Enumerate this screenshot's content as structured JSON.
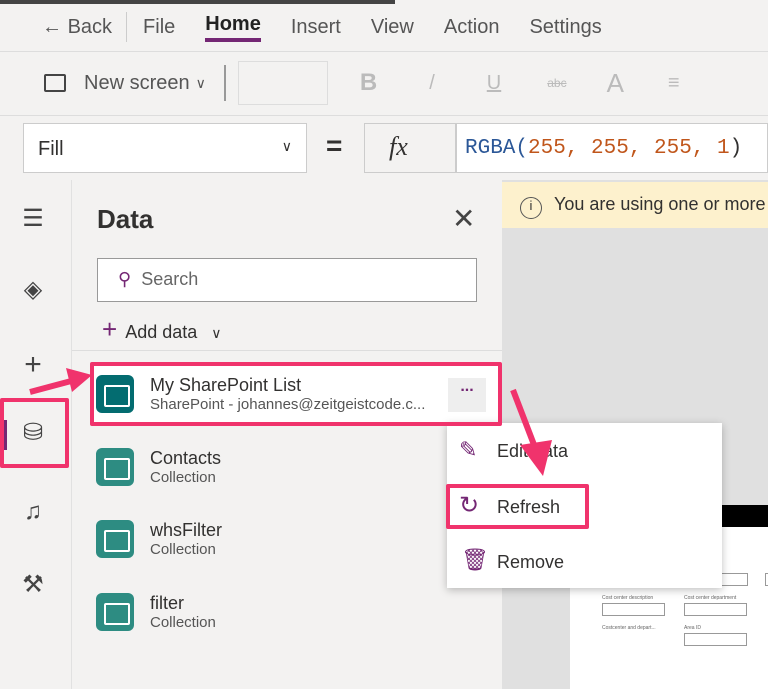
{
  "menu": {
    "back": "Back",
    "items": [
      "File",
      "Home",
      "Insert",
      "View",
      "Action",
      "Settings"
    ]
  },
  "toolbar": {
    "new_screen": "New screen"
  },
  "formula": {
    "property": "Fill",
    "equals": "=",
    "fx": "fx",
    "fn": "RGBA(",
    "args": "255, 255, 255, 1",
    ")": ")"
  },
  "banner": {
    "text": "You are using one or more"
  },
  "panel": {
    "title": "Data",
    "search_placeholder": "Search",
    "add_data": "Add data",
    "items": [
      {
        "name": "My SharePoint List",
        "sub": "SharePoint - johannes@zeitgeistcode.c..."
      },
      {
        "name": "Contacts",
        "sub": "Collection"
      },
      {
        "name": "whsFilter",
        "sub": "Collection"
      },
      {
        "name": "filter",
        "sub": "Collection"
      }
    ],
    "more": "..."
  },
  "context_menu": {
    "items": [
      "Edit data",
      "Refresh",
      "Remove"
    ]
  },
  "form": {
    "labels": [
      "Cost center description",
      "Cost center department",
      "Costcenter and depart...",
      "Area ID"
    ]
  },
  "colors": {
    "accent": "#742774",
    "highlight": "#f0336c",
    "teal": "#2d8c82"
  }
}
